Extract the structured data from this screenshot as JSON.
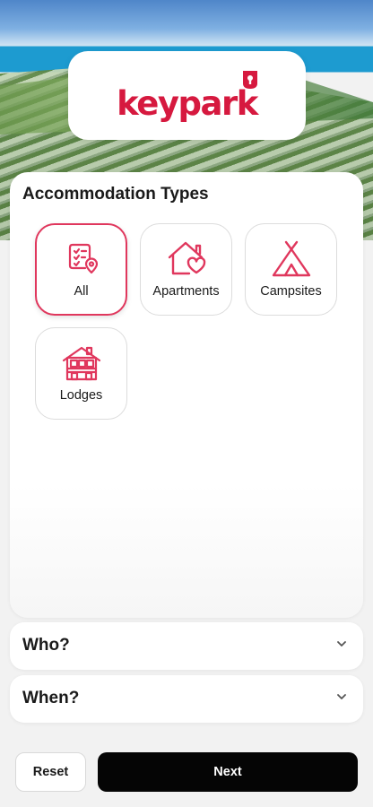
{
  "brand": {
    "logo_text": "keypark",
    "accent_color": "#d6193f"
  },
  "accommodation": {
    "title": "Accommodation Types",
    "types": [
      {
        "label": "All",
        "icon": "checklist-location-icon",
        "selected": true
      },
      {
        "label": "Apartments",
        "icon": "house-heart-icon",
        "selected": false
      },
      {
        "label": "Campsites",
        "icon": "tent-icon",
        "selected": false
      },
      {
        "label": "Lodges",
        "icon": "lodge-icon",
        "selected": false
      }
    ]
  },
  "sections": {
    "who": "Who?",
    "when": "When?"
  },
  "footer": {
    "reset_label": "Reset",
    "next_label": "Next"
  }
}
